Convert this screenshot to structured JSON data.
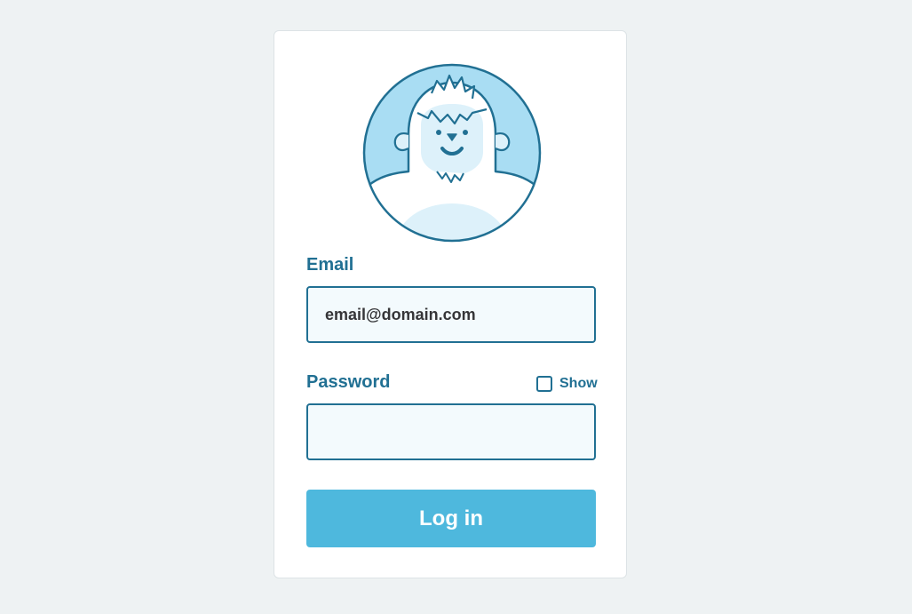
{
  "avatar": {
    "icon": "yeti-avatar-icon",
    "colors": {
      "background": "#a9ddf3",
      "outline": "#217093",
      "fur": "#ffffff",
      "face": "#ddf1fa"
    }
  },
  "email": {
    "label": "Email",
    "value": "email@domain.com",
    "placeholder": ""
  },
  "password": {
    "label": "Password",
    "value": "",
    "placeholder": "",
    "show_label": "Show",
    "show_checked": false
  },
  "login": {
    "label": "Log in"
  },
  "colors": {
    "page_background": "#eef2f3",
    "card_background": "#ffffff",
    "accent": "#217093",
    "input_background": "#f3fafd",
    "button": "#4eb8dd",
    "button_text": "#ffffff"
  }
}
